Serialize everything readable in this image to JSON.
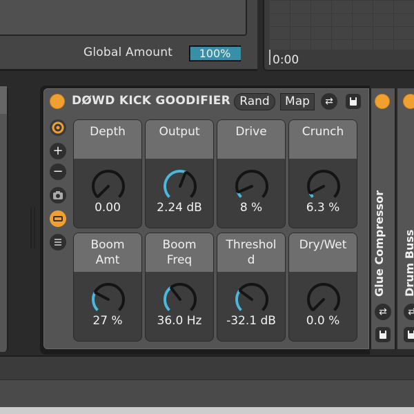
{
  "global": {
    "label": "Global Amount",
    "value": "100%",
    "value_fraction": 1.0
  },
  "timeline": {
    "time": "0:00"
  },
  "device": {
    "title": "DØWD KICK GOODIFIER",
    "rand_label": "Rand",
    "map_label": "Map",
    "macros": [
      {
        "name": "Depth",
        "value": "0.00",
        "fraction": 0.0
      },
      {
        "name": "Output",
        "value": "2.24 dB",
        "fraction": 0.58
      },
      {
        "name": "Drive",
        "value": "8 %",
        "fraction": 0.08
      },
      {
        "name": "Crunch",
        "value": "6.3 %",
        "fraction": 0.063
      },
      {
        "name": "Boom\nAmt",
        "value": "27 %",
        "fraction": 0.27
      },
      {
        "name": "Boom\nFreq",
        "value": "36.0 Hz",
        "fraction": 0.36
      },
      {
        "name": "Threshol\nd",
        "value": "-32.1 dB",
        "fraction": 0.3
      },
      {
        "name": "Dry/Wet",
        "value": "0.0 %",
        "fraction": 0.0
      }
    ]
  },
  "chain": {
    "glue_title": "Glue Compressor",
    "drum_title": "Drum Buss"
  },
  "colors": {
    "accent": "#f0a030",
    "knob_blue": "#4db8dd",
    "title_text": "#e6e6e6"
  }
}
